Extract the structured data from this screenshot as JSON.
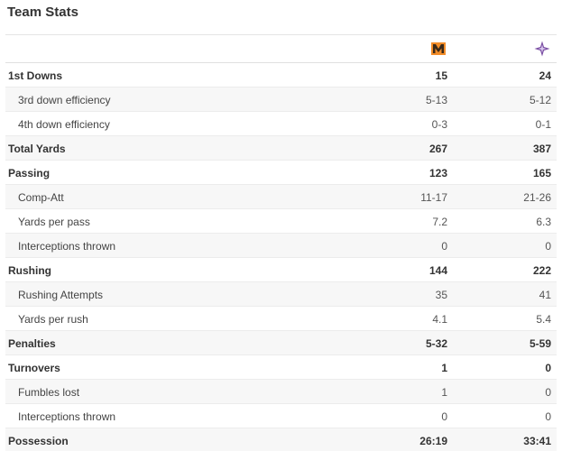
{
  "title": "Team Stats",
  "teams": [
    {
      "icon": "team-m-logo-icon",
      "color": "#f28c28"
    },
    {
      "icon": "team-star-logo-icon",
      "color": "#7b4fa3"
    }
  ],
  "rows": [
    {
      "label": "1st Downs",
      "a": "15",
      "b": "24",
      "type": "main"
    },
    {
      "label": "3rd down efficiency",
      "a": "5-13",
      "b": "5-12",
      "type": "sub"
    },
    {
      "label": "4th down efficiency",
      "a": "0-3",
      "b": "0-1",
      "type": "sub"
    },
    {
      "label": "Total Yards",
      "a": "267",
      "b": "387",
      "type": "main"
    },
    {
      "label": "Passing",
      "a": "123",
      "b": "165",
      "type": "main"
    },
    {
      "label": "Comp-Att",
      "a": "11-17",
      "b": "21-26",
      "type": "sub"
    },
    {
      "label": "Yards per pass",
      "a": "7.2",
      "b": "6.3",
      "type": "sub"
    },
    {
      "label": "Interceptions thrown",
      "a": "0",
      "b": "0",
      "type": "sub"
    },
    {
      "label": "Rushing",
      "a": "144",
      "b": "222",
      "type": "main"
    },
    {
      "label": "Rushing Attempts",
      "a": "35",
      "b": "41",
      "type": "sub"
    },
    {
      "label": "Yards per rush",
      "a": "4.1",
      "b": "5.4",
      "type": "sub"
    },
    {
      "label": "Penalties",
      "a": "5-32",
      "b": "5-59",
      "type": "main"
    },
    {
      "label": "Turnovers",
      "a": "1",
      "b": "0",
      "type": "main"
    },
    {
      "label": "Fumbles lost",
      "a": "1",
      "b": "0",
      "type": "sub"
    },
    {
      "label": "Interceptions thrown",
      "a": "0",
      "b": "0",
      "type": "sub"
    },
    {
      "label": "Possession",
      "a": "26:19",
      "b": "33:41",
      "type": "main"
    }
  ]
}
